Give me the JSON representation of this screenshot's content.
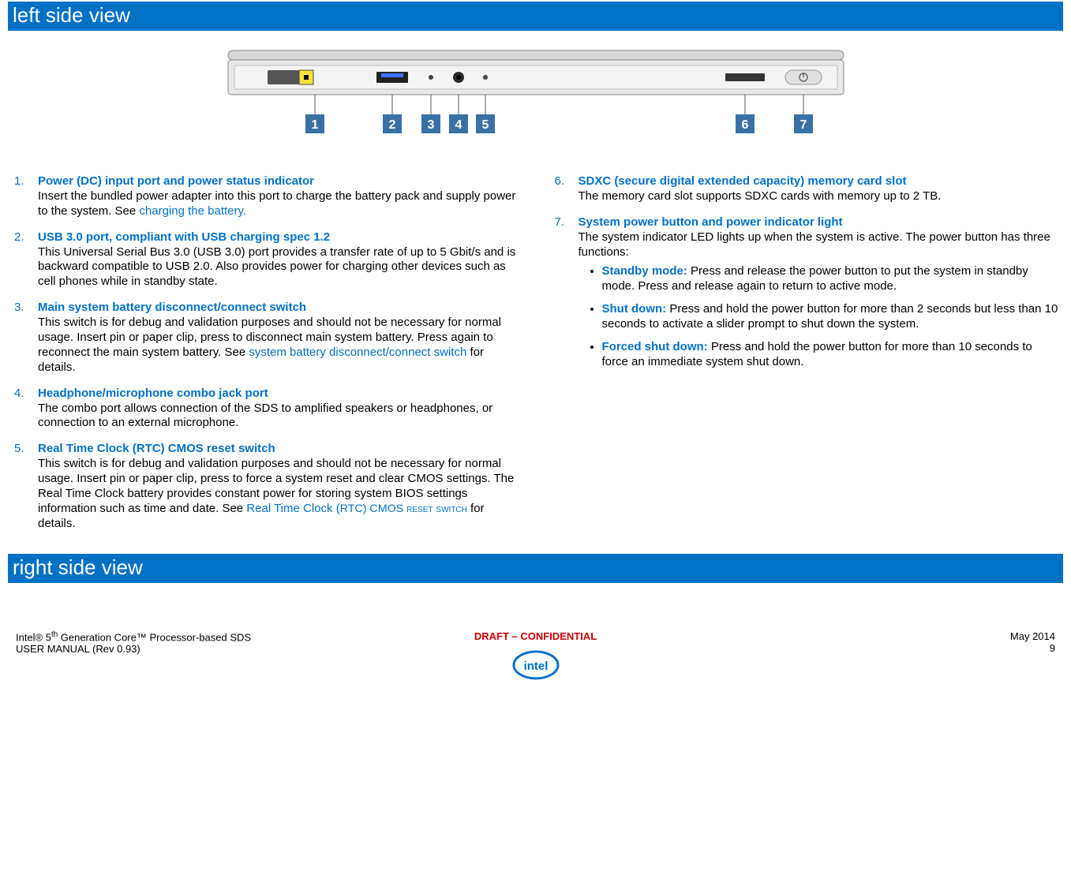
{
  "section1_title": "left side view",
  "section2_title": "right side view",
  "callouts": [
    "1",
    "2",
    "3",
    "4",
    "5",
    "6",
    "7"
  ],
  "items_left": [
    {
      "num": "1.",
      "title": "Power (DC) input port and power status indicator",
      "body": "Insert the bundled power adapter into this port to charge the battery pack and supply power to the system. See ",
      "link": "charging the battery."
    },
    {
      "num": "2.",
      "title": "USB 3.0 port, compliant with USB charging spec 1.2",
      "body": "This Universal Serial Bus 3.0 (USB 3.0) port provides a transfer rate of up to 5 Gbit/s and is backward compatible to USB 2.0. Also provides power for charging other devices such as cell phones while in standby state."
    },
    {
      "num": "3.",
      "title": "Main system battery disconnect/connect switch",
      "body": "This switch is for debug and validation purposes and should not be necessary for normal usage. Insert pin or paper clip, press to disconnect main system battery. Press again to reconnect the main system battery. See ",
      "link": "system battery disconnect/connect switch",
      "body_after": " for details."
    },
    {
      "num": "4.",
      "title": "Headphone/microphone combo jack port",
      "body": "The combo port allows connection of the SDS to amplified speakers or headphones, or connection to an external microphone."
    },
    {
      "num": "5.",
      "title": "Real Time Clock (RTC) CMOS reset switch",
      "body": "This switch is for debug and validation purposes and should not be necessary for normal usage. Insert pin or paper clip, press to force a system reset and clear CMOS settings. The Real Time Clock battery provides constant power for storing system BIOS settings information such as time and date. See ",
      "link_pre": "Real Time Clock (",
      "link_sc": "RTC) CMOS reset switch",
      "body_after": " for details."
    }
  ],
  "items_right": [
    {
      "num": "6.",
      "title": "SDXC (secure digital extended capacity) memory card slot",
      "body": "The memory card slot supports SDXC cards with memory up to 2 TB."
    },
    {
      "num": "7.",
      "title": "System power button and power indicator light",
      "body": "The system indicator LED lights up when the system is active. The power button has three functions:",
      "sub": [
        {
          "title": "Standby mode:",
          "body": " Press and release the power button to put the system in standby mode. Press and release again to return to active mode."
        },
        {
          "title": "Shut down:",
          "body": " Press and hold the power button for more than 2 seconds but less than 10 seconds to activate a slider prompt to shut down the system."
        },
        {
          "title": "Forced shut down:",
          "body": " Press and hold the power button for more than 10 seconds to force an immediate system shut down."
        }
      ]
    }
  ],
  "footer": {
    "left_line1_pre": "Intel® 5",
    "left_line1_sup": "th",
    "left_line1_post": " Generation Core™ Processor-based SDS",
    "left_line2": "USER MANUAL (Rev 0.93)",
    "center": "DRAFT – CONFIDENTIAL",
    "right_line1": "May 2014",
    "right_line2": "9"
  }
}
